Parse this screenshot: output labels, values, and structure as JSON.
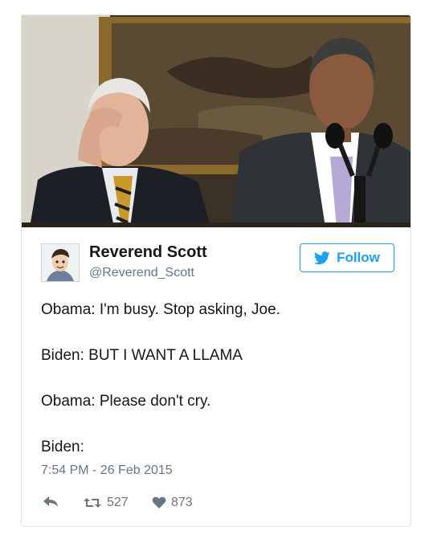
{
  "tweet": {
    "display_name": "Reverend Scott",
    "handle": "@Reverend_Scott",
    "follow_label": "Follow",
    "lines": [
      "Obama: I'm busy. Stop asking, Joe.",
      "Biden: BUT I WANT A LLAMA",
      "Obama: Please don't cry.",
      "Biden:"
    ],
    "timestamp": "7:54 PM - 26 Feb 2015",
    "retweets": "527",
    "likes": "873"
  },
  "icons": {
    "follow": "twitter-bird-icon",
    "reply": "reply-arrow-icon",
    "retweet": "retweet-icon",
    "like": "heart-icon"
  },
  "colors": {
    "accent": "#1da1f2",
    "secondary_text": "#657786",
    "border": "#e1e8ed"
  }
}
